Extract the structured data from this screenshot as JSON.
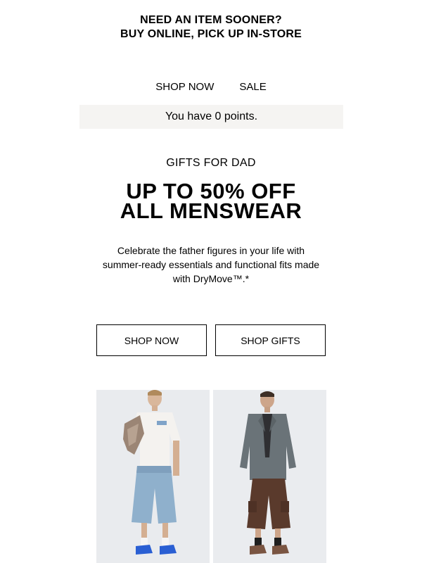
{
  "banner": {
    "line1": "NEED AN ITEM SOONER?",
    "line2": "BUY ONLINE, PICK UP IN-STORE"
  },
  "nav": {
    "shop_now": "SHOP NOW",
    "sale": "SALE"
  },
  "points": {
    "text": "You have 0 points."
  },
  "promo": {
    "eyebrow": "GIFTS FOR DAD",
    "headline_line1": "UP TO 50% OFF",
    "headline_line2": "ALL MENSWEAR",
    "body": "Celebrate the father figures in your life with summer-ready essentials and functional fits made with DryMove™.*"
  },
  "buttons": {
    "shop_now": "SHOP NOW",
    "shop_gifts": "SHOP GIFTS"
  },
  "colors": {
    "points_bg": "#f5f4f2",
    "tile_bg": "#eaecee"
  }
}
